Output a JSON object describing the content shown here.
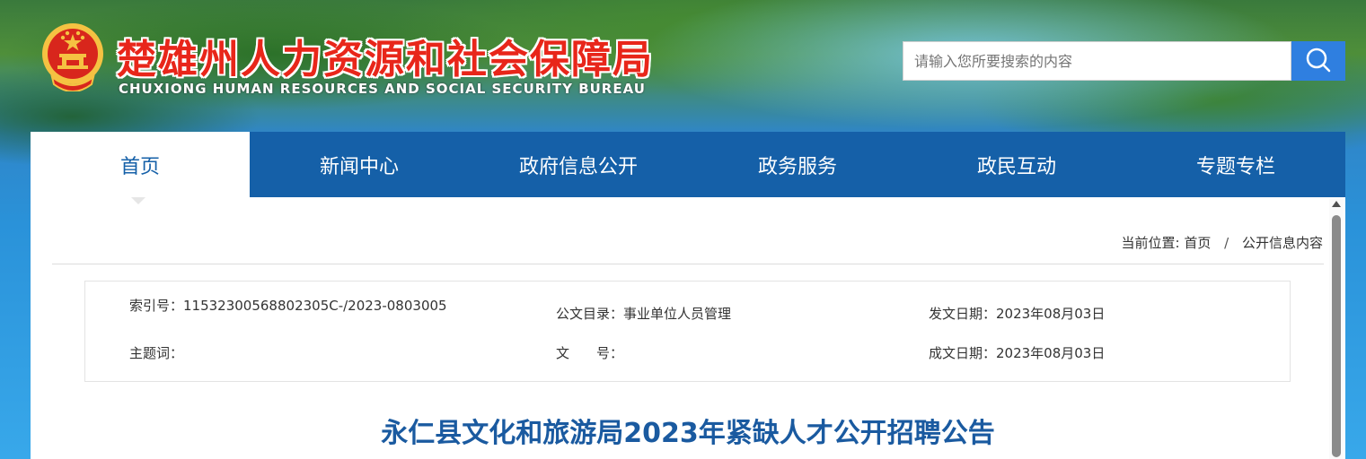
{
  "header": {
    "title": "楚雄州人力资源和社会保障局",
    "subtitle": "CHUXIONG HUMAN RESOURCES AND SOCIAL SECURITY BUREAU",
    "emblem_icon": "national-emblem-icon",
    "title_color": "#e8261a"
  },
  "search": {
    "placeholder": "请输入您所要搜索的内容",
    "button_icon": "search-icon",
    "button_color": "#2f7fe0"
  },
  "nav": {
    "color": "#1560a8",
    "items": [
      {
        "label": "首页",
        "active": true
      },
      {
        "label": "新闻中心",
        "active": false
      },
      {
        "label": "政府信息公开",
        "active": false
      },
      {
        "label": "政务服务",
        "active": false
      },
      {
        "label": "政民互动",
        "active": false
      },
      {
        "label": "专题专栏",
        "active": false
      }
    ]
  },
  "breadcrumb": {
    "prefix": "当前位置:",
    "home": "首页",
    "separator": "/",
    "current": "公开信息内容"
  },
  "meta": {
    "index_no": "索引号：11532300568802305C-/2023-0803005",
    "catalog": "公文目录：事业单位人员管理",
    "issue_date": "发文日期：2023年08月03日",
    "keywords": "主题词：",
    "doc_no": "文　　号：",
    "created_date": "成文日期：2023年08月03日"
  },
  "article": {
    "title": "永仁县文化和旅游局2023年紧缺人才公开招聘公告"
  }
}
